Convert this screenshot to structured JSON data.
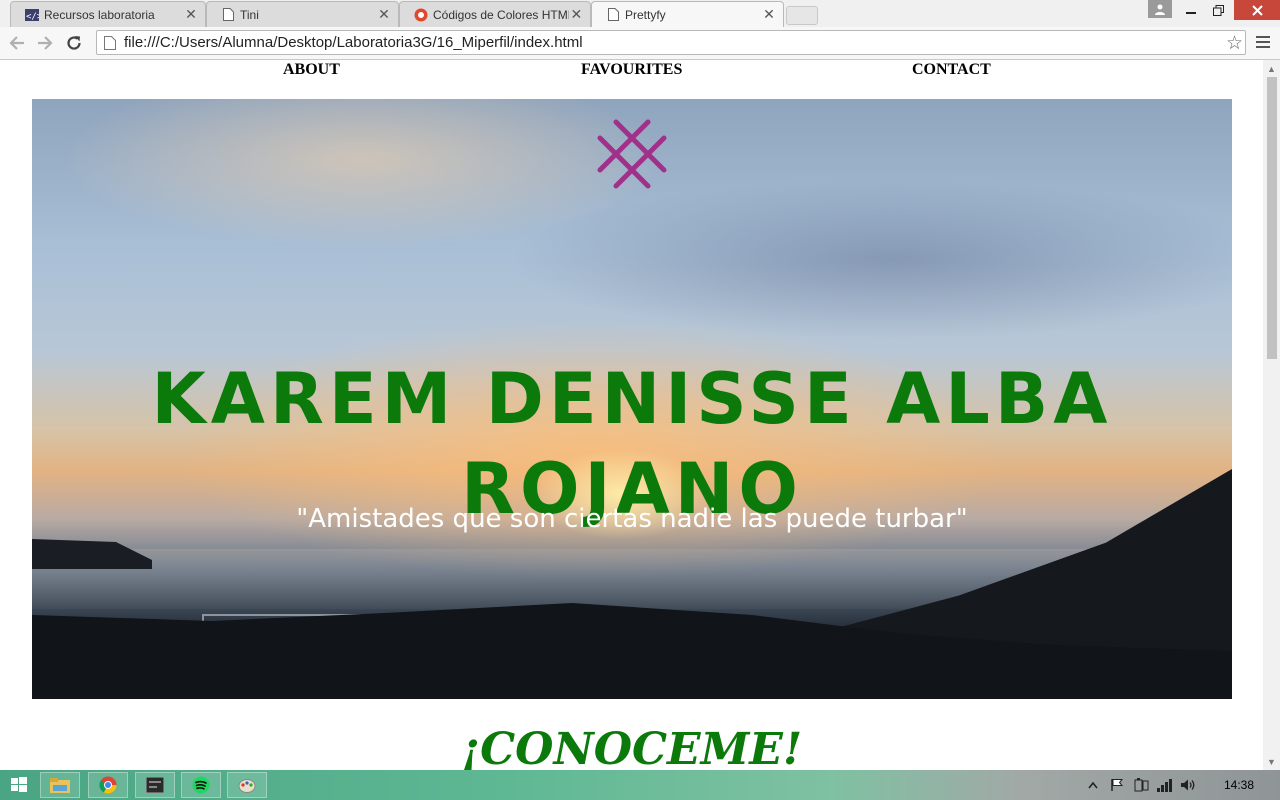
{
  "browser": {
    "tabs": [
      {
        "title": "Recursos laboratoria",
        "favicon": "code-icon",
        "active": false
      },
      {
        "title": "Tini",
        "favicon": "page-icon",
        "active": false
      },
      {
        "title": "Códigos de Colores HTML",
        "favicon": "web-icon",
        "active": false
      },
      {
        "title": "Prettyfy",
        "favicon": "page-icon",
        "active": true
      }
    ],
    "url": "file:///C:/Users/Alumna/Desktop/Laboratoria3G/16_Miperfil/index.html"
  },
  "page": {
    "nav": {
      "about": "ABOUT",
      "favourites": "FAVOURITES",
      "contact": "CONTACT"
    },
    "hero": {
      "name": "KAREM DENISSE ALBA ROJANO",
      "quote": "\"Amistades que son ciertas nadie las puede turbar\""
    },
    "section_title": "¡CONOCEME!"
  },
  "taskbar": {
    "clock": "14:38",
    "apps": [
      "file-explorer-icon",
      "chrome-icon",
      "terminal-icon",
      "spotify-icon",
      "paint-icon"
    ]
  },
  "colors": {
    "name_green": "#0b7a0b",
    "logo_magenta": "#a0308a",
    "close_red": "#c7473b"
  }
}
